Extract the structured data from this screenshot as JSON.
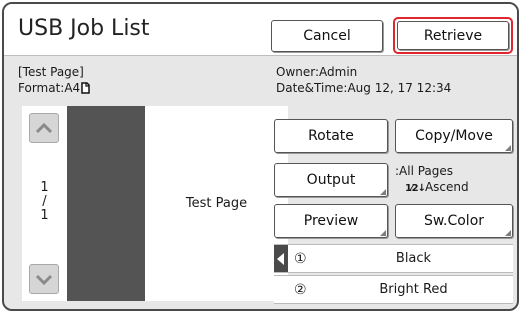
{
  "header": {
    "title": "USB Job List",
    "cancel_label": "Cancel",
    "retrieve_label": "Retrieve"
  },
  "job": {
    "name_line": "[Test Page]",
    "format_line": "Format:A4",
    "owner_line": "Owner:Admin",
    "datetime_line": "Date&Time:Aug 12, 17 12:34"
  },
  "preview": {
    "page_label": "Test Page",
    "page_current": "1",
    "page_sep": "/",
    "page_total": "1"
  },
  "actions": {
    "rotate_label": "Rotate",
    "copy_move_label": "Copy/Move",
    "output_label": "Output",
    "output_pages": ":All Pages",
    "output_order": "Ascend",
    "preview_label": "Preview",
    "sw_color_label": "Sw.Color"
  },
  "colors": [
    {
      "num": "①",
      "name": "Black"
    },
    {
      "num": "②",
      "name": "Bright Red"
    }
  ],
  "icons": {
    "scroll_up": "chevron-up-icon",
    "scroll_down": "chevron-down-icon",
    "format": "document-portrait-icon",
    "sort": "sort-ascending-icon",
    "drum_marker": "triangle-left-icon"
  },
  "theme": {
    "highlight": "#e0262f",
    "dark_bg": "#545454",
    "panel_bg": "#e7e7e7"
  }
}
